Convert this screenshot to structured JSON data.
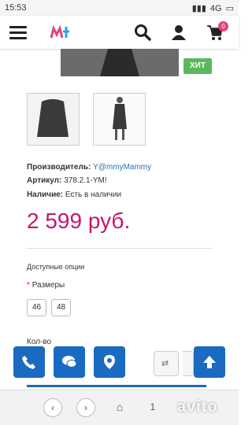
{
  "status_bar": {
    "time": "15:53",
    "network": "4G"
  },
  "header": {
    "cart_count": "0"
  },
  "badge": "ХИТ",
  "product": {
    "producer_label": "Производитель:",
    "producer_value": "Y@mmyMammy",
    "sku_label": "Артикул:",
    "sku_value": "378.2.1-YM!",
    "stock_label": "Наличие:",
    "stock_value": "Есть в наличии",
    "price": "2 599 руб."
  },
  "options": {
    "title": "Доступные опции",
    "sizes_label": "Размеры",
    "required_mark": "*",
    "sizes": [
      "46",
      "48"
    ]
  },
  "quantity_label": "Кол-во",
  "navbar": {
    "page": "1"
  },
  "watermark": "avito",
  "colors": {
    "brand_blue": "#1a6ac2",
    "price": "#c2186b",
    "hit": "#5cb85c",
    "badge": "#e0457b"
  }
}
